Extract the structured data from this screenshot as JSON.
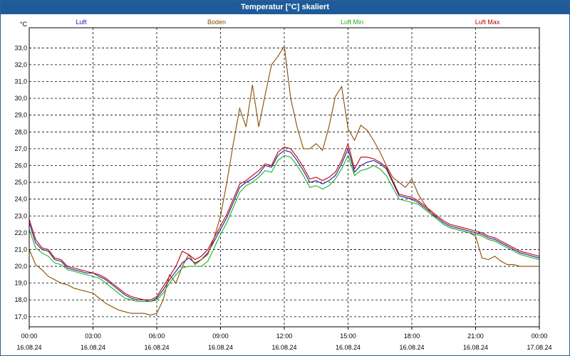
{
  "window": {
    "title": "Temperatur [°C] skaliert"
  },
  "chart_data": {
    "type": "line",
    "title": "Temperatur [°C] skaliert",
    "ylabel": "°C",
    "xlim": [
      0,
      24
    ],
    "ylim": [
      16.4,
      34.2
    ],
    "grid": true,
    "legend_position": "top",
    "yticks": [
      "17,0",
      "18,0",
      "19,0",
      "20,0",
      "21,0",
      "22,0",
      "23,0",
      "24,0",
      "25,0",
      "26,0",
      "27,0",
      "28,0",
      "29,0",
      "30,0",
      "31,0",
      "32,0",
      "33,0"
    ],
    "xticks": [
      {
        "time": "00:00",
        "date": "16.08.24"
      },
      {
        "time": "03:00",
        "date": "16.08.24"
      },
      {
        "time": "06:00",
        "date": "16.08.24"
      },
      {
        "time": "09:00",
        "date": "16.08.24"
      },
      {
        "time": "12:00",
        "date": "16.08.24"
      },
      {
        "time": "15:00",
        "date": "16.08.24"
      },
      {
        "time": "18:00",
        "date": "16.08.24"
      },
      {
        "time": "21:00",
        "date": "16.08.24"
      },
      {
        "time": "00:00",
        "date": "17.08.24"
      }
    ],
    "series": [
      {
        "name": "Luft",
        "color": "#1a1aa0",
        "x": [
          0,
          0.3,
          0.6,
          0.9,
          1.2,
          1.5,
          1.8,
          2.1,
          2.4,
          2.7,
          3.0,
          3.3,
          3.6,
          3.9,
          4.2,
          4.5,
          4.8,
          5.1,
          5.4,
          5.7,
          6.0,
          6.3,
          6.6,
          6.9,
          7.2,
          7.5,
          7.8,
          8.1,
          8.4,
          8.7,
          9.0,
          9.3,
          9.6,
          9.9,
          10.2,
          10.5,
          10.8,
          11.1,
          11.4,
          11.7,
          12.0,
          12.3,
          12.6,
          12.9,
          13.2,
          13.5,
          13.8,
          14.1,
          14.4,
          14.7,
          15.0,
          15.3,
          15.6,
          15.9,
          16.2,
          16.5,
          16.8,
          17.1,
          17.4,
          17.7,
          18.0,
          18.3,
          18.6,
          18.9,
          19.2,
          19.5,
          19.8,
          20.1,
          20.4,
          20.7,
          21.0,
          21.3,
          21.6,
          21.9,
          22.2,
          22.5,
          22.8,
          23.1,
          23.4,
          23.7,
          24.0
        ],
        "values": [
          22.6,
          21.4,
          21.0,
          20.9,
          20.4,
          20.3,
          19.9,
          19.8,
          19.7,
          19.6,
          19.6,
          19.4,
          19.2,
          18.9,
          18.6,
          18.3,
          18.1,
          18.0,
          18.0,
          17.9,
          18.1,
          18.6,
          19.2,
          19.7,
          20.2,
          20.5,
          20.2,
          20.4,
          20.8,
          21.5,
          22.2,
          22.9,
          23.8,
          24.7,
          25.0,
          25.2,
          25.5,
          26.0,
          25.9,
          26.6,
          26.9,
          26.8,
          26.3,
          25.7,
          25.0,
          25.1,
          24.9,
          25.1,
          25.4,
          26.1,
          27.0,
          25.6,
          26.0,
          26.2,
          26.3,
          26.1,
          25.8,
          25.0,
          24.2,
          24.1,
          24.0,
          23.8,
          23.5,
          23.2,
          22.9,
          22.6,
          22.4,
          22.3,
          22.2,
          22.1,
          22.0,
          21.9,
          21.7,
          21.6,
          21.4,
          21.2,
          21.0,
          20.8,
          20.7,
          20.6,
          20.5
        ]
      },
      {
        "name": "Boden",
        "color": "#8b4b00",
        "x": [
          0,
          0.3,
          0.6,
          0.9,
          1.2,
          1.5,
          1.8,
          2.1,
          2.4,
          2.7,
          3.0,
          3.3,
          3.6,
          3.9,
          4.2,
          4.5,
          4.8,
          5.1,
          5.4,
          5.7,
          6.0,
          6.3,
          6.6,
          6.9,
          7.2,
          7.5,
          7.8,
          8.1,
          8.4,
          8.7,
          9.0,
          9.3,
          9.6,
          9.9,
          10.2,
          10.5,
          10.8,
          11.1,
          11.4,
          11.7,
          12.0,
          12.3,
          12.6,
          12.9,
          13.2,
          13.5,
          13.8,
          14.1,
          14.4,
          14.7,
          15.0,
          15.3,
          15.6,
          15.9,
          16.2,
          16.5,
          16.8,
          17.1,
          17.4,
          17.7,
          18.0,
          18.3,
          18.6,
          18.9,
          19.2,
          19.5,
          19.8,
          20.1,
          20.4,
          20.7,
          21.0,
          21.3,
          21.6,
          21.9,
          22.2,
          22.5,
          22.8,
          23.1,
          23.4,
          23.7,
          24.0
        ],
        "values": [
          21.0,
          20.1,
          19.8,
          19.4,
          19.2,
          19.0,
          18.9,
          18.7,
          18.6,
          18.5,
          18.4,
          18.1,
          17.8,
          17.6,
          17.4,
          17.3,
          17.2,
          17.2,
          17.2,
          17.1,
          17.2,
          18.0,
          19.5,
          19.0,
          20.0,
          20.7,
          20.1,
          20.4,
          20.7,
          21.7,
          23.0,
          25.0,
          27.3,
          29.4,
          28.3,
          30.8,
          28.3,
          30.2,
          32.0,
          32.5,
          33.1,
          30.0,
          28.3,
          27.0,
          27.0,
          27.3,
          26.9,
          28.3,
          30.1,
          30.7,
          28.2,
          27.5,
          28.4,
          28.1,
          27.5,
          26.8,
          26.0,
          25.3,
          25.0,
          24.7,
          25.2,
          24.3,
          23.7,
          23.2,
          22.8,
          22.5,
          22.3,
          22.2,
          22.1,
          22.0,
          21.8,
          20.5,
          20.4,
          20.6,
          20.3,
          20.1,
          20.1,
          20.0,
          20.0,
          20.0,
          20.0
        ]
      },
      {
        "name": "Luft Min",
        "color": "#1eb01e",
        "x": [
          0,
          0.3,
          0.6,
          0.9,
          1.2,
          1.5,
          1.8,
          2.1,
          2.4,
          2.7,
          3.0,
          3.3,
          3.6,
          3.9,
          4.2,
          4.5,
          4.8,
          5.1,
          5.4,
          5.7,
          6.0,
          6.3,
          6.6,
          6.9,
          7.2,
          7.5,
          7.8,
          8.1,
          8.4,
          8.7,
          9.0,
          9.3,
          9.6,
          9.9,
          10.2,
          10.5,
          10.8,
          11.1,
          11.4,
          11.7,
          12.0,
          12.3,
          12.6,
          12.9,
          13.2,
          13.5,
          13.8,
          14.1,
          14.4,
          14.7,
          15.0,
          15.3,
          15.6,
          15.9,
          16.2,
          16.5,
          16.8,
          17.1,
          17.4,
          17.7,
          18.0,
          18.3,
          18.6,
          18.9,
          19.2,
          19.5,
          19.8,
          20.1,
          20.4,
          20.7,
          21.0,
          21.3,
          21.6,
          21.9,
          22.2,
          22.5,
          22.8,
          23.1,
          23.4,
          23.7,
          24.0
        ],
        "values": [
          22.2,
          21.1,
          20.8,
          20.6,
          20.2,
          20.1,
          19.8,
          19.7,
          19.6,
          19.5,
          19.4,
          19.3,
          19.0,
          18.7,
          18.4,
          18.1,
          18.0,
          17.9,
          17.9,
          17.9,
          18.0,
          18.4,
          19.0,
          19.5,
          19.9,
          20.0,
          20.0,
          20.0,
          20.3,
          21.1,
          21.9,
          22.6,
          23.5,
          24.4,
          24.8,
          25.0,
          25.3,
          25.7,
          25.6,
          26.3,
          26.6,
          26.5,
          26.0,
          25.4,
          24.7,
          24.8,
          24.6,
          24.8,
          25.2,
          25.8,
          26.6,
          25.4,
          25.7,
          25.8,
          26.0,
          25.8,
          25.4,
          24.7,
          24.0,
          23.9,
          23.8,
          23.7,
          23.4,
          23.1,
          22.8,
          22.5,
          22.3,
          22.2,
          22.1,
          22.0,
          21.9,
          21.8,
          21.6,
          21.5,
          21.3,
          21.1,
          20.9,
          20.7,
          20.6,
          20.5,
          20.4
        ]
      },
      {
        "name": "Luft Max",
        "color": "#c00000",
        "x": [
          0,
          0.3,
          0.6,
          0.9,
          1.2,
          1.5,
          1.8,
          2.1,
          2.4,
          2.7,
          3.0,
          3.3,
          3.6,
          3.9,
          4.2,
          4.5,
          4.8,
          5.1,
          5.4,
          5.7,
          6.0,
          6.3,
          6.6,
          6.9,
          7.2,
          7.5,
          7.8,
          8.1,
          8.4,
          8.7,
          9.0,
          9.3,
          9.6,
          9.9,
          10.2,
          10.5,
          10.8,
          11.1,
          11.4,
          11.7,
          12.0,
          12.3,
          12.6,
          12.9,
          13.2,
          13.5,
          13.8,
          14.1,
          14.4,
          14.7,
          15.0,
          15.3,
          15.6,
          15.9,
          16.2,
          16.5,
          16.8,
          17.1,
          17.4,
          17.7,
          18.0,
          18.3,
          18.6,
          18.9,
          19.2,
          19.5,
          19.8,
          20.1,
          20.4,
          20.7,
          21.0,
          21.3,
          21.6,
          21.9,
          22.2,
          22.5,
          22.8,
          23.1,
          23.4,
          23.7,
          24.0
        ],
        "values": [
          22.8,
          21.6,
          21.1,
          21.0,
          20.5,
          20.4,
          20.0,
          19.9,
          19.8,
          19.7,
          19.6,
          19.5,
          19.3,
          19.0,
          18.7,
          18.4,
          18.2,
          18.1,
          18.0,
          18.0,
          18.2,
          18.8,
          19.4,
          20.0,
          20.9,
          20.7,
          20.4,
          20.6,
          21.0,
          21.7,
          22.4,
          23.1,
          24.0,
          24.9,
          25.1,
          25.4,
          25.7,
          26.1,
          26.0,
          26.8,
          27.1,
          27.0,
          26.5,
          25.9,
          25.2,
          25.3,
          25.1,
          25.3,
          25.6,
          26.3,
          27.3,
          25.8,
          26.5,
          26.5,
          26.4,
          26.2,
          25.9,
          25.1,
          24.3,
          24.2,
          24.1,
          23.9,
          23.6,
          23.3,
          23.0,
          22.7,
          22.5,
          22.4,
          22.3,
          22.2,
          22.1,
          22.0,
          21.8,
          21.7,
          21.5,
          21.3,
          21.1,
          20.9,
          20.8,
          20.7,
          20.6
        ]
      }
    ]
  }
}
